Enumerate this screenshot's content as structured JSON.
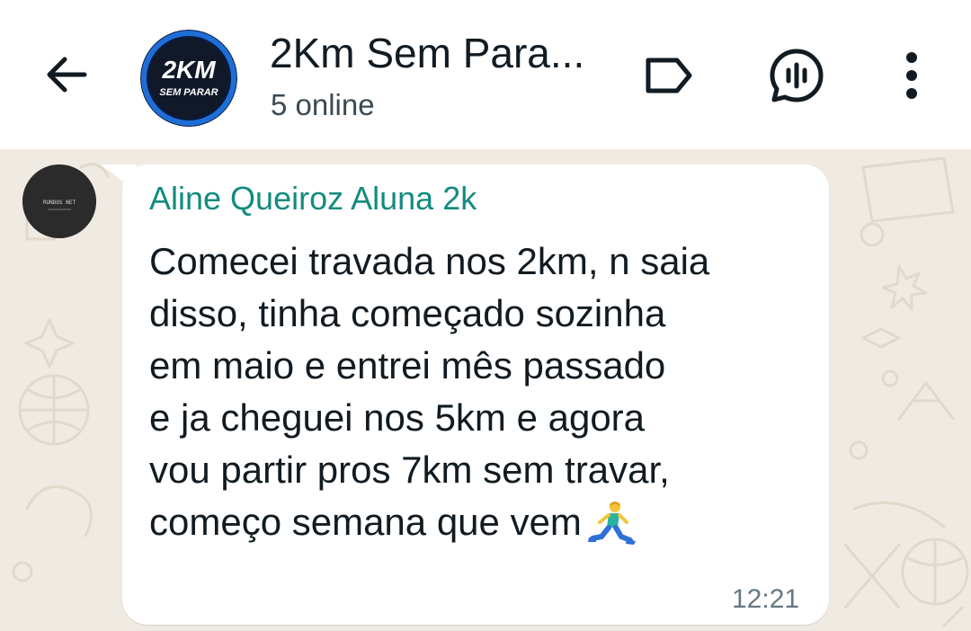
{
  "header": {
    "title": "2Km Sem Para...",
    "subtitle": "5 online",
    "avatar_text_main": "2KM",
    "avatar_text_sub": "SEM PARAR",
    "back_icon": "arrow-left-icon",
    "actions": [
      "label-tag-icon",
      "voice-chat-icon",
      "more-vert-icon"
    ]
  },
  "message": {
    "sender_avatar_text": "RUNDOS NET",
    "sender_name": "Aline Queiroz Aluna 2k",
    "text": "Comecei travada nos 2km, n saia\ndisso, tinha começado sozinha\nem maio e entrei mês passado\ne ja cheguei nos 5km e agora\nvou partir pros 7km sem travar,\ncomeço semana que vem",
    "emoji": "person-running-icon",
    "time": "12:21"
  },
  "colors": {
    "sender_name": "#128c7e",
    "chat_background": "#f0ebe2",
    "bubble": "#ffffff",
    "avatar_ring": "#1e6ed8"
  }
}
